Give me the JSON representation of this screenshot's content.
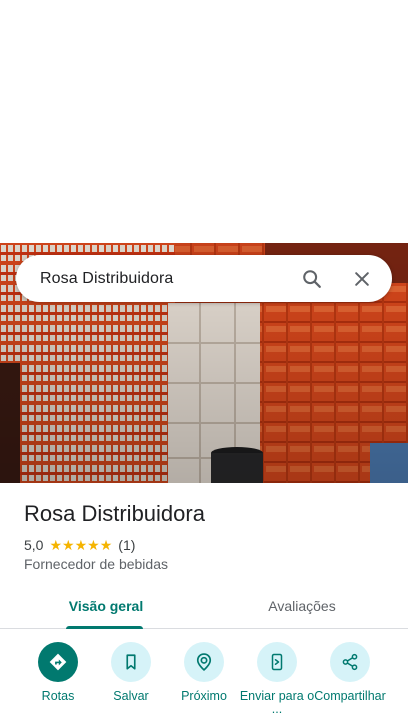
{
  "search": {
    "query": "Rosa Distribuidora"
  },
  "place": {
    "name": "Rosa Distribuidora",
    "rating": "5,0",
    "star_count": 5,
    "review_count": "(1)",
    "category": "Fornecedor de bebidas"
  },
  "tabs": [
    {
      "label": "Visão geral",
      "selected": true
    },
    {
      "label": "Avaliações",
      "selected": false
    }
  ],
  "actions": [
    {
      "label": "Rotas",
      "icon": "directions-icon"
    },
    {
      "label": "Salvar",
      "icon": "bookmark-icon"
    },
    {
      "label": "Próximo",
      "icon": "nearby-icon"
    },
    {
      "label": "Enviar para o ...",
      "icon": "send-to-phone-icon"
    },
    {
      "label": "Compartilhar",
      "icon": "share-icon"
    }
  ],
  "colors": {
    "accent": "#01796f",
    "action_bg": "#d6f3f8",
    "star": "#f5b400"
  }
}
